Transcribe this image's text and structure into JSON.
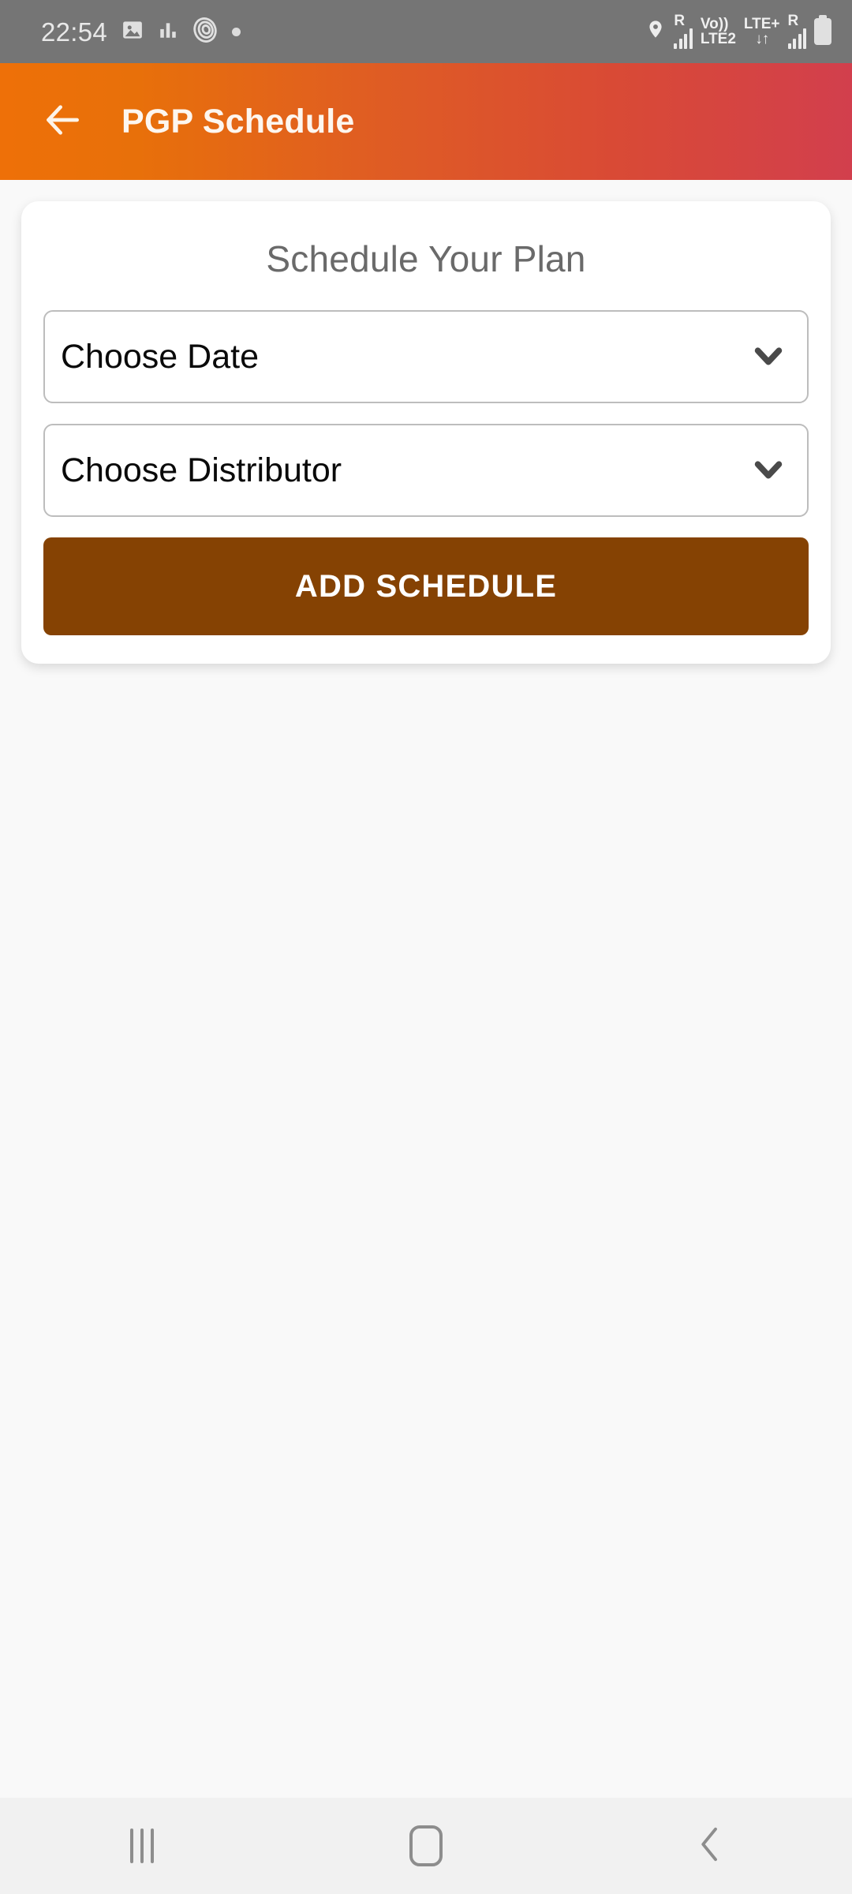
{
  "status_bar": {
    "clock": "22:54",
    "left_icons": [
      "image-icon",
      "bar-chart-icon",
      "spiral-icon",
      "dot-indicator-icon"
    ],
    "right_icons": [
      "location-icon",
      "signal-sim1-icon",
      "volte-icon",
      "data-arrows-icon",
      "signal-sim2-icon",
      "battery-icon"
    ],
    "sim1_roaming_label": "R",
    "volte_label": "Vo))",
    "lte2_label": "LTE2",
    "lte_plus_label": "LTE+",
    "sim2_roaming_label": "R",
    "background_color": "#757575"
  },
  "app_bar": {
    "back_icon": "arrow-left-icon",
    "title": "PGP Schedule",
    "gradient_start": "#ee7008",
    "gradient_end": "#d23f4d"
  },
  "card": {
    "title": "Schedule Your Plan",
    "fields": [
      {
        "name": "date",
        "label": "Choose Date",
        "icon": "chevron-down-icon"
      },
      {
        "name": "distributor",
        "label": "Choose Distributor",
        "icon": "chevron-down-icon"
      }
    ],
    "submit_button": {
      "label": "ADD SCHEDULE",
      "color": "#854203",
      "text_color": "#ffffff"
    }
  },
  "nav_bar": {
    "recents_icon": "recents-icon",
    "home_icon": "home-icon",
    "back_icon": "chevron-left-icon",
    "background_color": "#f1f1f1"
  },
  "page": {
    "background_color": "#f9f9f9"
  }
}
